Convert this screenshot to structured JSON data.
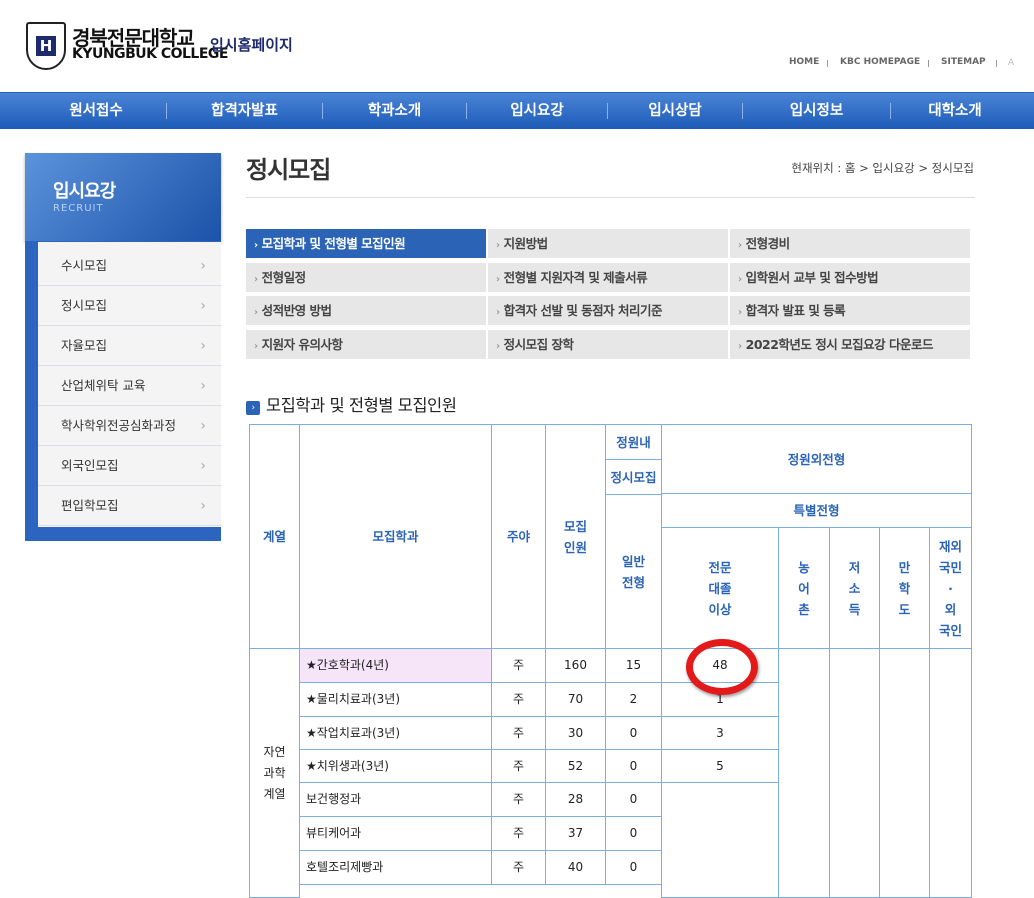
{
  "header": {
    "logo_korean": "경북전문대학교",
    "logo_english": "KYUNGBUK COLLEGE",
    "site_title": "입시홈페이지",
    "util_links": [
      "HOME",
      "KBC HOMEPAGE",
      "SITEMAP"
    ],
    "font_size_label": "A"
  },
  "gnb": [
    "원서접수",
    "합격자발표",
    "학과소개",
    "입시요강",
    "입시상담",
    "입시정보",
    "대학소개"
  ],
  "lnb": {
    "title": "입시요강",
    "subtitle": "RECRUIT",
    "items": [
      "수시모집",
      "정시모집",
      "자율모집",
      "산업체위탁 교육",
      "학사학위전공심화과정",
      "외국인모집",
      "편입학모집"
    ]
  },
  "page": {
    "title": "정시모집",
    "breadcrumb": "현재위치 : 홈 > 입시요강 > 정시모집",
    "section_title": "모집학과 및 전형별 모집인원"
  },
  "tabs": [
    "모집학과 및 전형별 모집인원",
    "지원방법",
    "전형경비",
    "전형일정",
    "전형별 지원자격 및 제출서류",
    "입학원서 교부 및 접수방법",
    "성적반영 방법",
    "합격자 선발 및 동점자 처리기준",
    "합격자 발표 및 등록",
    "지원자 유의사항",
    "정시모집 장학",
    "2022학년도 정시 모집요강 다운로드"
  ],
  "table": {
    "headers": {
      "field": "계열",
      "dept": "모집학과",
      "daynight": "주야",
      "quota": "모집\n인원",
      "regular": "정원내",
      "jeongsi": "정시모집",
      "general": "일반\n전형",
      "outside": "정원외전형",
      "special": "특별전형",
      "college_grad": "전문\n대졸\n이상",
      "rural": "농\n어\n촌",
      "lowincome": "저\n소\n득",
      "nk": "만\n학\n도",
      "overseas": "재외\n국민\n·\n외\n국인"
    },
    "group": "자연\n과학\n계열",
    "rows": [
      {
        "dept": "★간호학과(4년)",
        "dn": "주",
        "quota": "160",
        "general": "15",
        "grad": "48"
      },
      {
        "dept": "★물리치료과(3년)",
        "dn": "주",
        "quota": "70",
        "general": "2",
        "grad": "1"
      },
      {
        "dept": "★작업치료과(3년)",
        "dn": "주",
        "quota": "30",
        "general": "0",
        "grad": "3"
      },
      {
        "dept": "★치위생과(3년)",
        "dn": "주",
        "quota": "52",
        "general": "0",
        "grad": "5"
      },
      {
        "dept": "보건행정과",
        "dn": "주",
        "quota": "28",
        "general": "0",
        "grad": ""
      },
      {
        "dept": "뷰티케어과",
        "dn": "주",
        "quota": "37",
        "general": "0",
        "grad": ""
      },
      {
        "dept": "호텔조리제빵과",
        "dn": "주",
        "quota": "40",
        "general": "0",
        "grad": ""
      }
    ]
  },
  "colors": {
    "accent": "#2b64b7",
    "nav": "#1d5bb8",
    "highlight": "#f6e4f8",
    "circle": "#e21a1a"
  }
}
